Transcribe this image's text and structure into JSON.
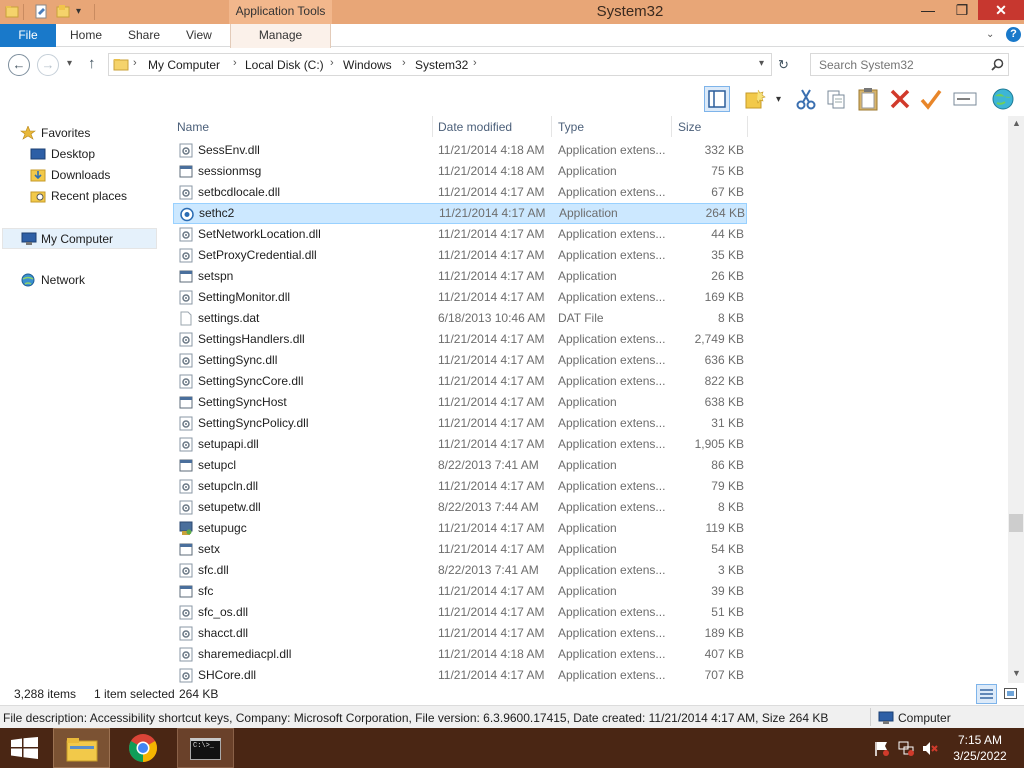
{
  "window": {
    "title": "System32",
    "context_tab_group": "Application Tools",
    "controls": {
      "minimize": "—",
      "maximize": "❐",
      "close": "✕"
    }
  },
  "ribbon": {
    "tabs": [
      "File",
      "Home",
      "Share",
      "View",
      "Manage"
    ],
    "help": "?"
  },
  "address": {
    "breadcrumbs": [
      "My Computer",
      "Local Disk (C:)",
      "Windows",
      "System32"
    ],
    "search_placeholder": "Search System32"
  },
  "toolbar": {
    "icons": [
      "preview-pane-icon",
      "new-folder-icon",
      "cut-icon",
      "copy-icon",
      "paste-icon",
      "delete-icon",
      "checkmark-icon",
      "rename-icon",
      "globe-icon"
    ]
  },
  "nav": {
    "favorites": "Favorites",
    "desktop": "Desktop",
    "downloads": "Downloads",
    "recent": "Recent places",
    "computer": "My Computer",
    "network": "Network"
  },
  "columns": {
    "name": "Name",
    "date": "Date modified",
    "type": "Type",
    "size": "Size"
  },
  "files": [
    {
      "name": "SessEnv.dll",
      "date": "11/21/2014 4:18 AM",
      "type": "Application extens...",
      "size": "332 KB",
      "icon": "dll"
    },
    {
      "name": "sessionmsg",
      "date": "11/21/2014 4:18 AM",
      "type": "Application",
      "size": "75 KB",
      "icon": "exe"
    },
    {
      "name": "setbcdlocale.dll",
      "date": "11/21/2014 4:17 AM",
      "type": "Application extens...",
      "size": "67 KB",
      "icon": "dll"
    },
    {
      "name": "sethc2",
      "date": "11/21/2014 4:17 AM",
      "type": "Application",
      "size": "264 KB",
      "icon": "sethc",
      "selected": true
    },
    {
      "name": "SetNetworkLocation.dll",
      "date": "11/21/2014 4:17 AM",
      "type": "Application extens...",
      "size": "44 KB",
      "icon": "dll"
    },
    {
      "name": "SetProxyCredential.dll",
      "date": "11/21/2014 4:17 AM",
      "type": "Application extens...",
      "size": "35 KB",
      "icon": "dll"
    },
    {
      "name": "setspn",
      "date": "11/21/2014 4:17 AM",
      "type": "Application",
      "size": "26 KB",
      "icon": "exe"
    },
    {
      "name": "SettingMonitor.dll",
      "date": "11/21/2014 4:17 AM",
      "type": "Application extens...",
      "size": "169 KB",
      "icon": "dll"
    },
    {
      "name": "settings.dat",
      "date": "6/18/2013 10:46 AM",
      "type": "DAT File",
      "size": "8 KB",
      "icon": "dat"
    },
    {
      "name": "SettingsHandlers.dll",
      "date": "11/21/2014 4:17 AM",
      "type": "Application extens...",
      "size": "2,749 KB",
      "icon": "dll"
    },
    {
      "name": "SettingSync.dll",
      "date": "11/21/2014 4:17 AM",
      "type": "Application extens...",
      "size": "636 KB",
      "icon": "dll"
    },
    {
      "name": "SettingSyncCore.dll",
      "date": "11/21/2014 4:17 AM",
      "type": "Application extens...",
      "size": "822 KB",
      "icon": "dll"
    },
    {
      "name": "SettingSyncHost",
      "date": "11/21/2014 4:17 AM",
      "type": "Application",
      "size": "638 KB",
      "icon": "exe"
    },
    {
      "name": "SettingSyncPolicy.dll",
      "date": "11/21/2014 4:17 AM",
      "type": "Application extens...",
      "size": "31 KB",
      "icon": "dll"
    },
    {
      "name": "setupapi.dll",
      "date": "11/21/2014 4:17 AM",
      "type": "Application extens...",
      "size": "1,905 KB",
      "icon": "dll"
    },
    {
      "name": "setupcl",
      "date": "8/22/2013 7:41 AM",
      "type": "Application",
      "size": "86 KB",
      "icon": "exe"
    },
    {
      "name": "setupcln.dll",
      "date": "11/21/2014 4:17 AM",
      "type": "Application extens...",
      "size": "79 KB",
      "icon": "dll"
    },
    {
      "name": "setupetw.dll",
      "date": "8/22/2013 7:44 AM",
      "type": "Application extens...",
      "size": "8 KB",
      "icon": "dll"
    },
    {
      "name": "setupugc",
      "date": "11/21/2014 4:17 AM",
      "type": "Application",
      "size": "119 KB",
      "icon": "setup"
    },
    {
      "name": "setx",
      "date": "11/21/2014 4:17 AM",
      "type": "Application",
      "size": "54 KB",
      "icon": "exe"
    },
    {
      "name": "sfc.dll",
      "date": "8/22/2013 7:41 AM",
      "type": "Application extens...",
      "size": "3 KB",
      "icon": "dll"
    },
    {
      "name": "sfc",
      "date": "11/21/2014 4:17 AM",
      "type": "Application",
      "size": "39 KB",
      "icon": "exe"
    },
    {
      "name": "sfc_os.dll",
      "date": "11/21/2014 4:17 AM",
      "type": "Application extens...",
      "size": "51 KB",
      "icon": "dll"
    },
    {
      "name": "shacct.dll",
      "date": "11/21/2014 4:17 AM",
      "type": "Application extens...",
      "size": "189 KB",
      "icon": "dll"
    },
    {
      "name": "sharemediacpl.dll",
      "date": "11/21/2014 4:18 AM",
      "type": "Application extens...",
      "size": "407 KB",
      "icon": "dll"
    },
    {
      "name": "SHCore.dll",
      "date": "11/21/2014 4:17 AM",
      "type": "Application extens...",
      "size": "707 KB",
      "icon": "dll"
    }
  ],
  "status": {
    "item_count": "3,288 items",
    "selected": "1 item selected",
    "selected_size": "264 KB"
  },
  "info": {
    "description": "File description: Accessibility shortcut keys, Company: Microsoft Corporation, File version: 6.3.9600.17415, Date created: 11/21/2014 4:17 AM, Size: 264",
    "size": "264 KB",
    "location": "Computer"
  },
  "taskbar": {
    "cmd_label": "C:\\>_",
    "time": "7:15 AM",
    "date": "3/25/2022"
  },
  "colors": {
    "titlebar": "#e8a677",
    "file_tab": "#1979ca",
    "selection": "#cce8ff",
    "taskbar": "#4a2614"
  }
}
